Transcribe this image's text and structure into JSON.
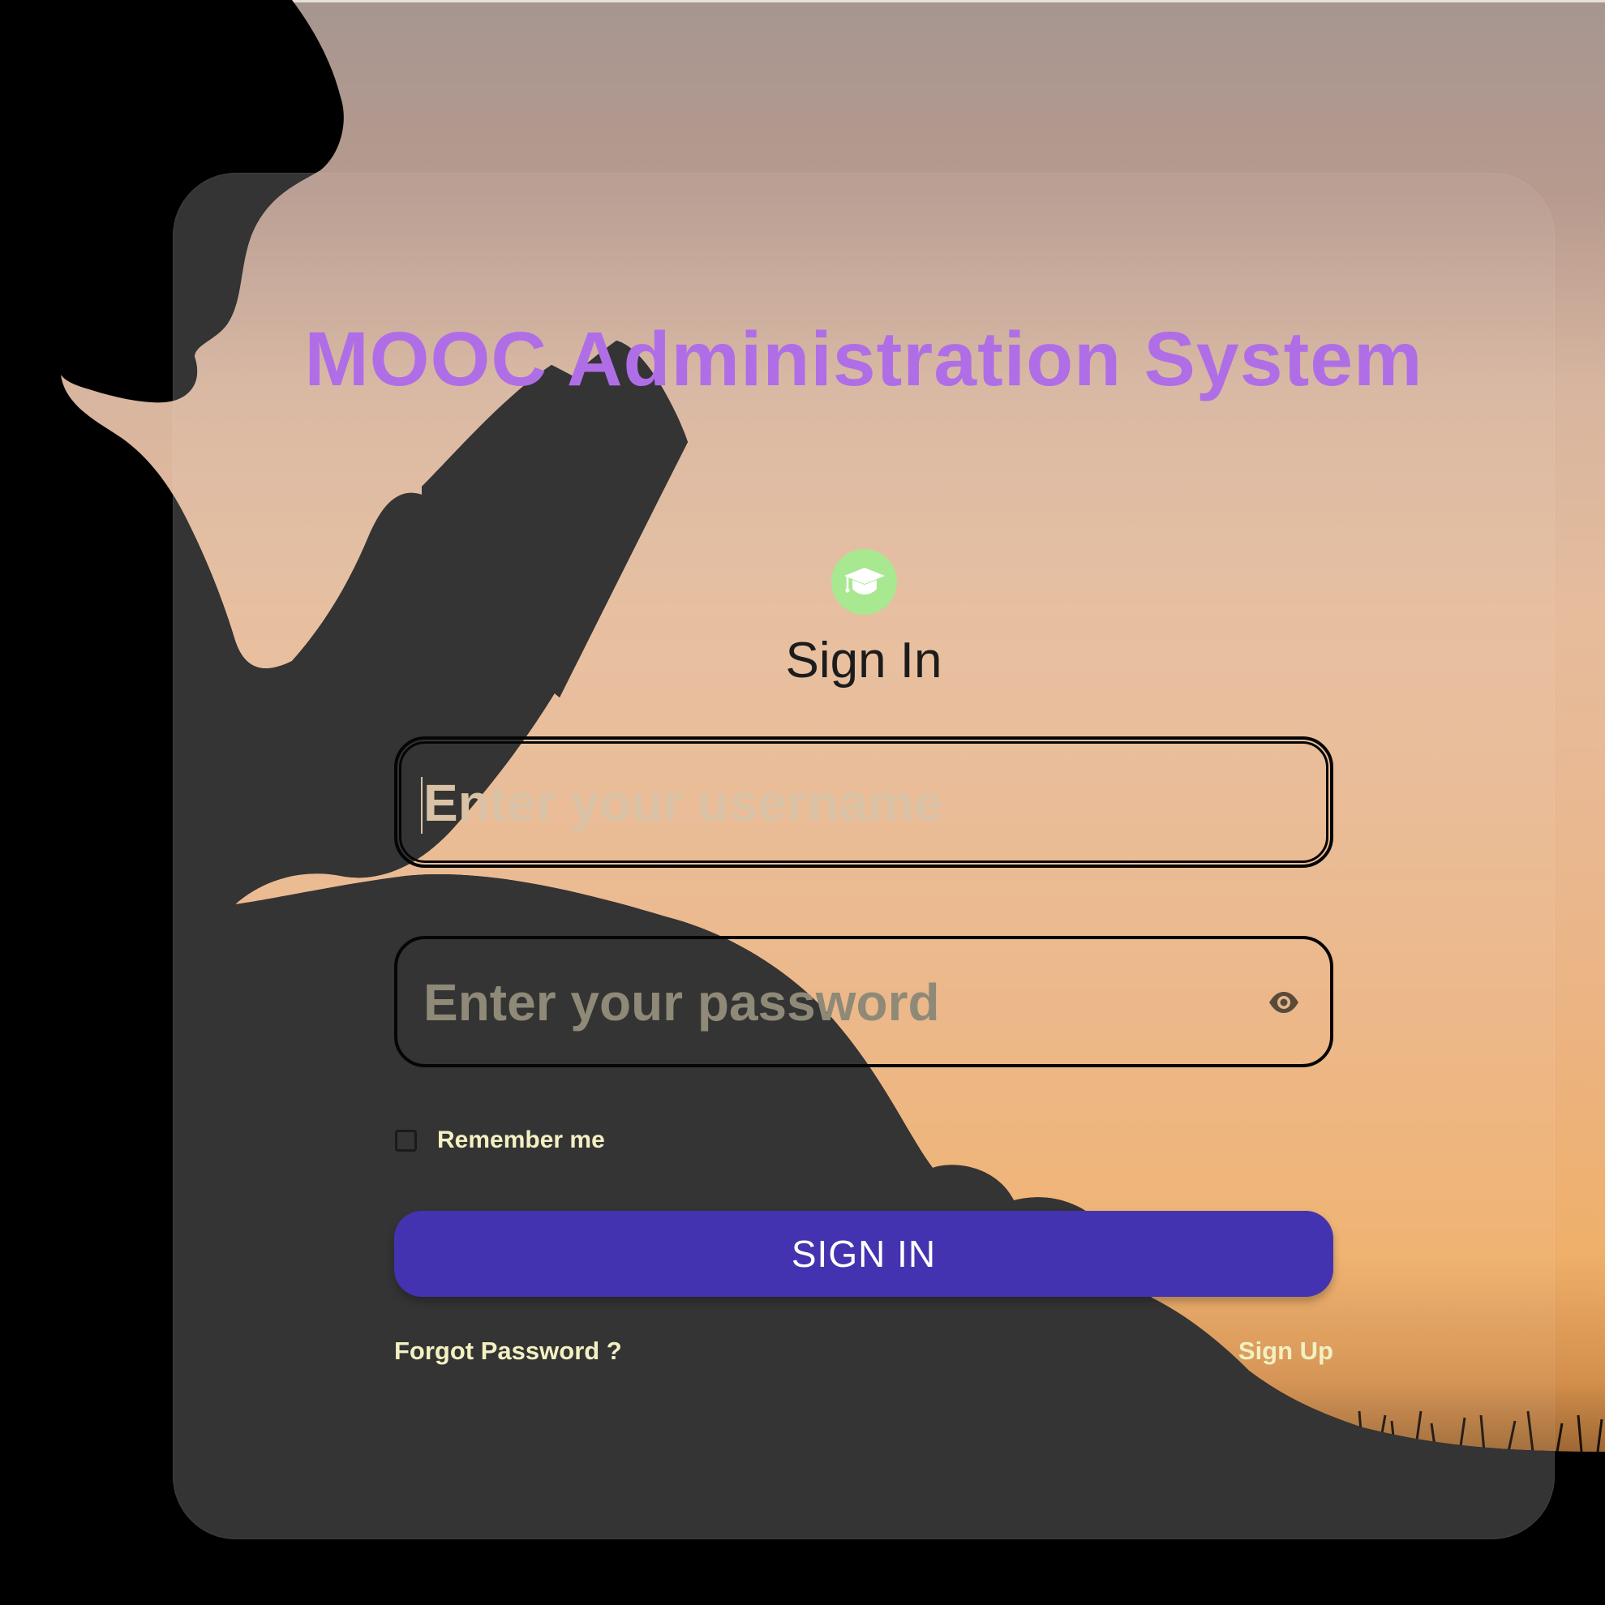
{
  "app": {
    "title": "MOOC Administration System"
  },
  "form": {
    "heading": "Sign In",
    "logo_icon": "graduation-cap-icon",
    "username": {
      "value": "",
      "placeholder": "Enter your username"
    },
    "password": {
      "value": "",
      "placeholder": "Enter your password",
      "toggle_icon": "eye-icon"
    },
    "remember": {
      "label": "Remember me",
      "checked": false
    },
    "submit_label": "SIGN IN",
    "forgot_label": "Forgot Password ?",
    "signup_label": "Sign Up"
  },
  "colors": {
    "title": "#b06ee6",
    "logo_bg": "#a8e890",
    "button_bg": "#4433b0",
    "link_text": "#f3f0c2",
    "card_overlay": "#343434"
  }
}
